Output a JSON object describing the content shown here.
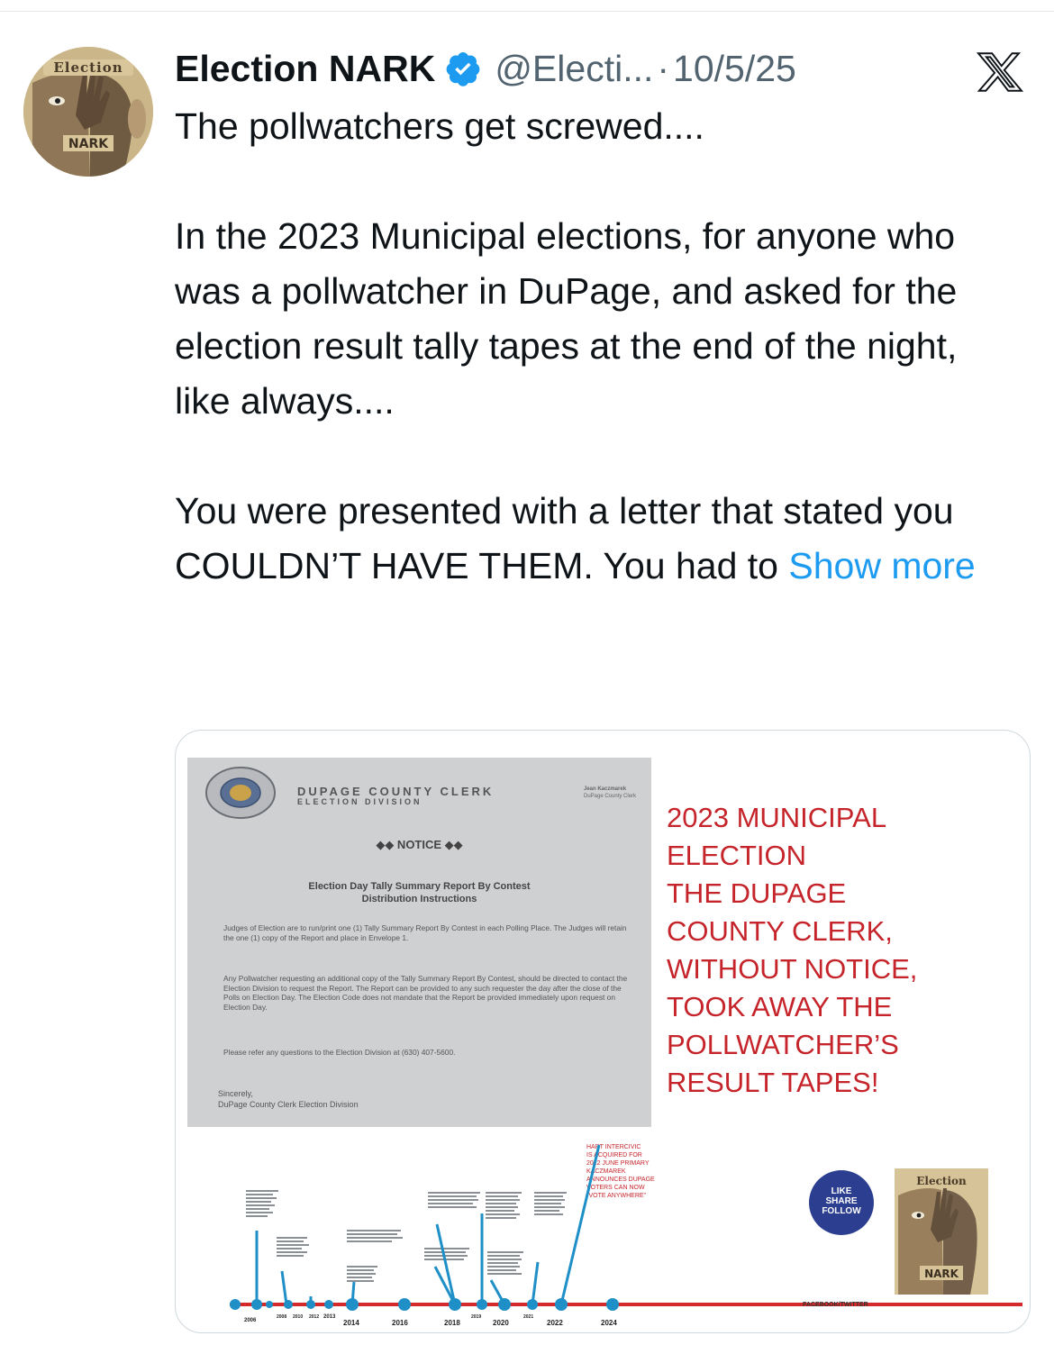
{
  "tweet": {
    "author_name": "Election NARK",
    "handle": "@Electi...",
    "separator": "·",
    "date": "10/5/25",
    "avatar_label_top": "Election",
    "avatar_label_bottom": "NARK",
    "paragraphs": [
      "The pollwatchers get screwed....",
      "In the 2023 Municipal elections, for anyone who was a pollwatcher in DuPage, and asked for the election result tally tapes at the end of the night, like always....",
      "You were presented with a letter that stated you COULDN’T HAVE THEM. You had to"
    ],
    "show_more": "Show more"
  },
  "image": {
    "letter": {
      "office": "DUPAGE COUNTY CLERK",
      "division": "ELECTION DIVISION",
      "signer_name": "Jean Kaczmarek",
      "signer_title": "DuPage County Clerk",
      "notice": "◆◆ NOTICE ◆◆",
      "title_line1": "Election Day Tally Summary Report By Contest",
      "title_line2": "Distribution Instructions",
      "para1": "Judges of Election are to run/print one (1) Tally Summary Report By Contest in each Polling Place. The Judges will retain the one (1) copy of the Report and place in Envelope 1.",
      "para2": "Any Pollwatcher requesting an additional copy of the Tally Summary Report By Contest, should be directed to contact the Election Division to request the Report. The Report can be provided to any such requester the day after the close of the Polls on Election Day. The Election Code does not mandate that the Report be provided immediately upon request on Election Day.",
      "para3": "Please refer any questions to the Election Division at (630) 407-5600.",
      "closing1": "Sincerely,",
      "closing2": "DuPage County Clerk Election Division"
    },
    "headline_lines": [
      "2023 MUNICIPAL",
      "ELECTION",
      "THE DUPAGE",
      "COUNTY CLERK,",
      "WITHOUT NOTICE,",
      "TOOK AWAY THE",
      "POLLWATCHER’S",
      "RESULT TAPES!"
    ],
    "timeline": {
      "years_major": [
        "2014",
        "2016",
        "2018",
        "2020",
        "2022",
        "2024"
      ],
      "years_minor": [
        "2006",
        "2008",
        "2010",
        "2012",
        "2013",
        "2019",
        "2021"
      ],
      "red_note": [
        "HART INTERCIVIC",
        "IS ACQUIRED FOR",
        "2022 JUNE PRIMARY",
        "KACZMAREK",
        "ANNOUNCES DUPAGE",
        "VOTERS CAN NOW",
        "\"VOTE ANYWHERE\""
      ]
    },
    "social_badge": [
      "LIKE",
      "SHARE",
      "FOLLOW"
    ],
    "social_caption": "FACEBOOK/TWITTER",
    "mini_logo_top": "Election",
    "mini_logo_bottom": "NARK"
  }
}
